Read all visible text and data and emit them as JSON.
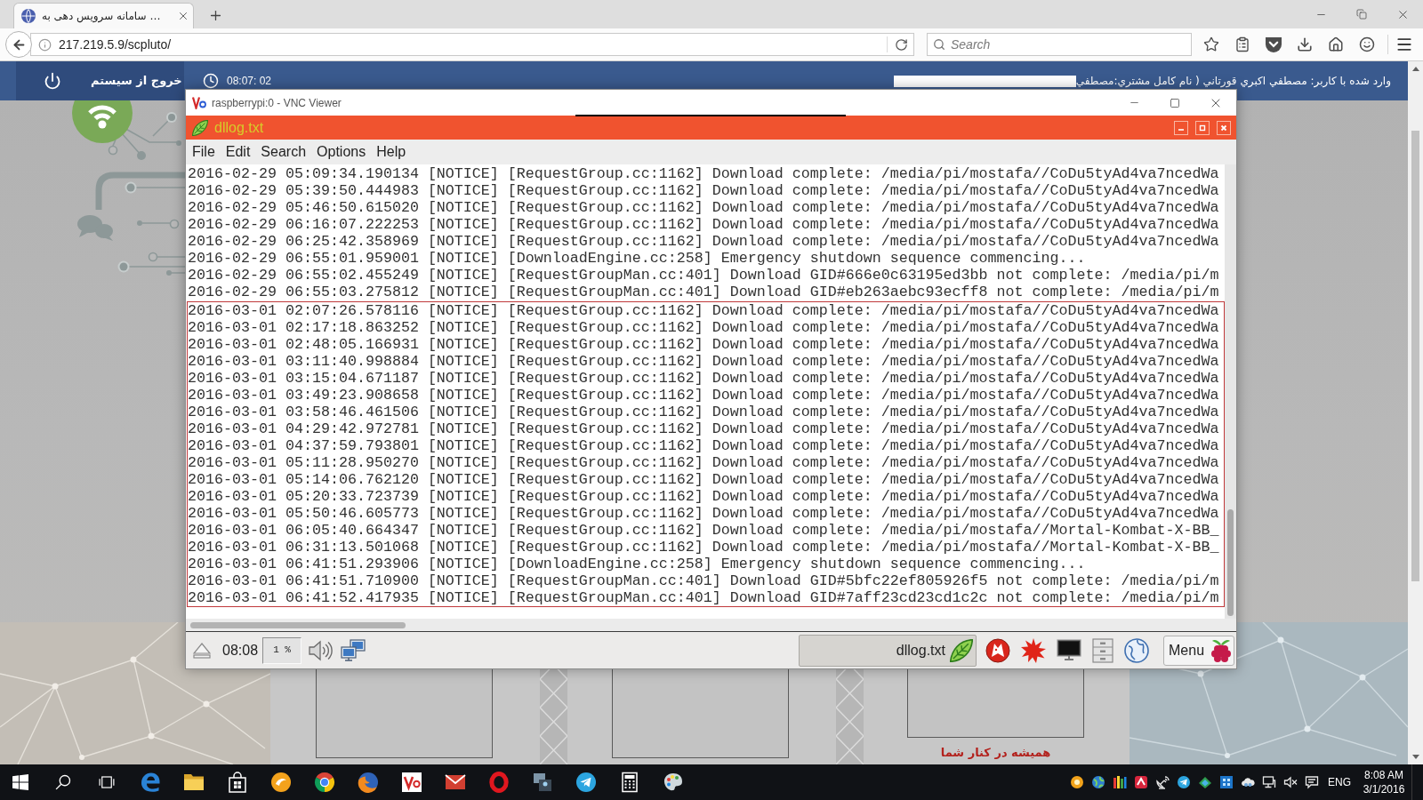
{
  "browser": {
    "tabs": [
      {
        "title": "سامانه سرویس دهی به …",
        "selected": true
      }
    ],
    "address": "217.219.5.9/scpluto/",
    "search": {
      "placeholder": "Search"
    }
  },
  "page": {
    "header": {
      "logout": "خروج از سیستم",
      "time": "08:07: 02",
      "user_info": "وارد شده با کاربر: مصطفي اكبري قورتاني ( نام كامل مشتري:مصطفي"
    },
    "slogan": "هميشه در كنار شما"
  },
  "vnc_window": {
    "title": "raspberrypi:0 - VNC Viewer",
    "editor": {
      "title": "dllog.txt",
      "menu": [
        "File",
        "Edit",
        "Search",
        "Options",
        "Help"
      ],
      "log_blocks": [
        {
          "highlighted": false,
          "lines": [
            "2016-02-29 05:09:34.190134 [NOTICE] [RequestGroup.cc:1162] Download complete: /media/pi/mostafa//CoDu5tyAd4va7ncedWa",
            "2016-02-29 05:39:50.444983 [NOTICE] [RequestGroup.cc:1162] Download complete: /media/pi/mostafa//CoDu5tyAd4va7ncedWa",
            "2016-02-29 05:46:50.615020 [NOTICE] [RequestGroup.cc:1162] Download complete: /media/pi/mostafa//CoDu5tyAd4va7ncedWa",
            "2016-02-29 06:16:07.222253 [NOTICE] [RequestGroup.cc:1162] Download complete: /media/pi/mostafa//CoDu5tyAd4va7ncedWa",
            "2016-02-29 06:25:42.358969 [NOTICE] [RequestGroup.cc:1162] Download complete: /media/pi/mostafa//CoDu5tyAd4va7ncedWa",
            "2016-02-29 06:55:01.959001 [NOTICE] [DownloadEngine.cc:258] Emergency shutdown sequence commencing...",
            "2016-02-29 06:55:02.455249 [NOTICE] [RequestGroupMan.cc:401] Download GID#666e0c63195ed3bb not complete: /media/pi/m",
            "2016-02-29 06:55:03.275812 [NOTICE] [RequestGroupMan.cc:401] Download GID#eb263aebc93ecff8 not complete: /media/pi/m"
          ]
        },
        {
          "highlighted": true,
          "lines": [
            "2016-03-01 02:07:26.578116 [NOTICE] [RequestGroup.cc:1162] Download complete: /media/pi/mostafa//CoDu5tyAd4va7ncedWa",
            "2016-03-01 02:17:18.863252 [NOTICE] [RequestGroup.cc:1162] Download complete: /media/pi/mostafa//CoDu5tyAd4va7ncedWa",
            "2016-03-01 02:48:05.166931 [NOTICE] [RequestGroup.cc:1162] Download complete: /media/pi/mostafa//CoDu5tyAd4va7ncedWa",
            "2016-03-01 03:11:40.998884 [NOTICE] [RequestGroup.cc:1162] Download complete: /media/pi/mostafa//CoDu5tyAd4va7ncedWa",
            "2016-03-01 03:15:04.671187 [NOTICE] [RequestGroup.cc:1162] Download complete: /media/pi/mostafa//CoDu5tyAd4va7ncedWa",
            "2016-03-01 03:49:23.908658 [NOTICE] [RequestGroup.cc:1162] Download complete: /media/pi/mostafa//CoDu5tyAd4va7ncedWa",
            "2016-03-01 03:58:46.461506 [NOTICE] [RequestGroup.cc:1162] Download complete: /media/pi/mostafa//CoDu5tyAd4va7ncedWa",
            "2016-03-01 04:29:42.972781 [NOTICE] [RequestGroup.cc:1162] Download complete: /media/pi/mostafa//CoDu5tyAd4va7ncedWa",
            "2016-03-01 04:37:59.793801 [NOTICE] [RequestGroup.cc:1162] Download complete: /media/pi/mostafa//CoDu5tyAd4va7ncedWa",
            "2016-03-01 05:11:28.950270 [NOTICE] [RequestGroup.cc:1162] Download complete: /media/pi/mostafa//CoDu5tyAd4va7ncedWa",
            "2016-03-01 05:14:06.762120 [NOTICE] [RequestGroup.cc:1162] Download complete: /media/pi/mostafa//CoDu5tyAd4va7ncedWa",
            "2016-03-01 05:20:33.723739 [NOTICE] [RequestGroup.cc:1162] Download complete: /media/pi/mostafa//CoDu5tyAd4va7ncedWa",
            "2016-03-01 05:50:46.605773 [NOTICE] [RequestGroup.cc:1162] Download complete: /media/pi/mostafa//CoDu5tyAd4va7ncedWa",
            "2016-03-01 06:05:40.664347 [NOTICE] [RequestGroup.cc:1162] Download complete: /media/pi/mostafa//Mortal-Kombat-X-BB_",
            "2016-03-01 06:31:13.501068 [NOTICE] [RequestGroup.cc:1162] Download complete: /media/pi/mostafa//Mortal-Kombat-X-BB_",
            "2016-03-01 06:41:51.293906 [NOTICE] [DownloadEngine.cc:258] Emergency shutdown sequence commencing...",
            "2016-03-01 06:41:51.710900 [NOTICE] [RequestGroupMan.cc:401] Download GID#5bfc22ef805926f5 not complete: /media/pi/m",
            "2016-03-01 06:41:52.417935 [NOTICE] [RequestGroupMan.cc:401] Download GID#7aff23cd23cd1c2c not complete: /media/pi/m"
          ]
        }
      ]
    },
    "panel": {
      "clock": "08:08",
      "cpu": "1 %",
      "windows": [
        {
          "title": "dllog.txt",
          "selected": true
        }
      ],
      "menu_button": "Menu"
    }
  },
  "taskbar": {
    "language": "ENG",
    "time": "8:08 AM",
    "date": "3/1/2016"
  }
}
